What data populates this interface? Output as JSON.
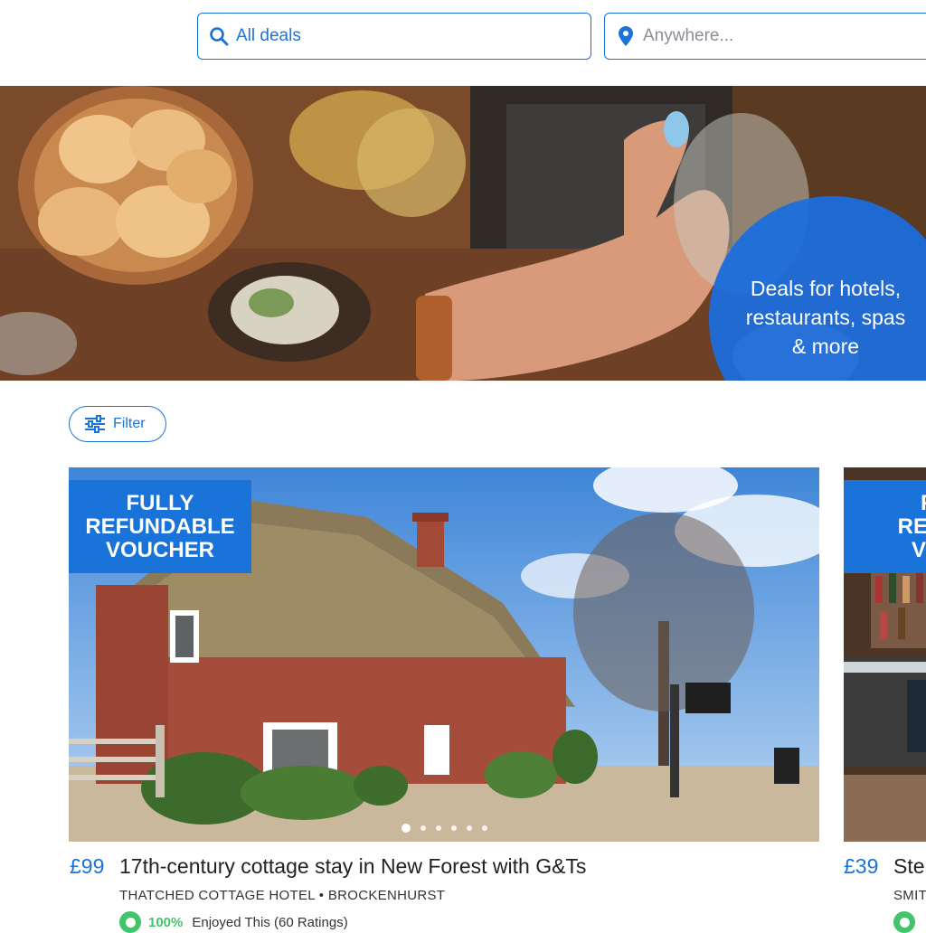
{
  "search": {
    "deals_value": "All deals",
    "location_placeholder": "Anywhere..."
  },
  "hero": {
    "headline_line1": "Deals for hotels,",
    "headline_line2": "restaurants, spas",
    "headline_line3": "& more",
    "social": [
      "facebook-icon",
      "twitter-icon",
      "email-icon"
    ]
  },
  "filter": {
    "label": "Filter"
  },
  "cards": [
    {
      "badge_line1": "FULLY",
      "badge_line2": "REFUNDABLE",
      "badge_line3": "VOUCHER",
      "price": "£99",
      "title": "17th-century cottage stay in New Forest with G&Ts",
      "subtitle": "THATCHED COTTAGE HOTEL • BROCKENHURST",
      "rating_pct": "100%",
      "rating_label": "Enjoyed This (60 Ratings)",
      "carousel_pages": 6,
      "carousel_active": 1
    },
    {
      "badge_line1": "FU",
      "badge_line2": "REFUN",
      "badge_line3": "VOU",
      "price": "£39",
      "title": "Ste",
      "subtitle": "SMIT"
    }
  ],
  "colors": {
    "accent": "#1a73d9",
    "rating_green": "#43c46a"
  }
}
